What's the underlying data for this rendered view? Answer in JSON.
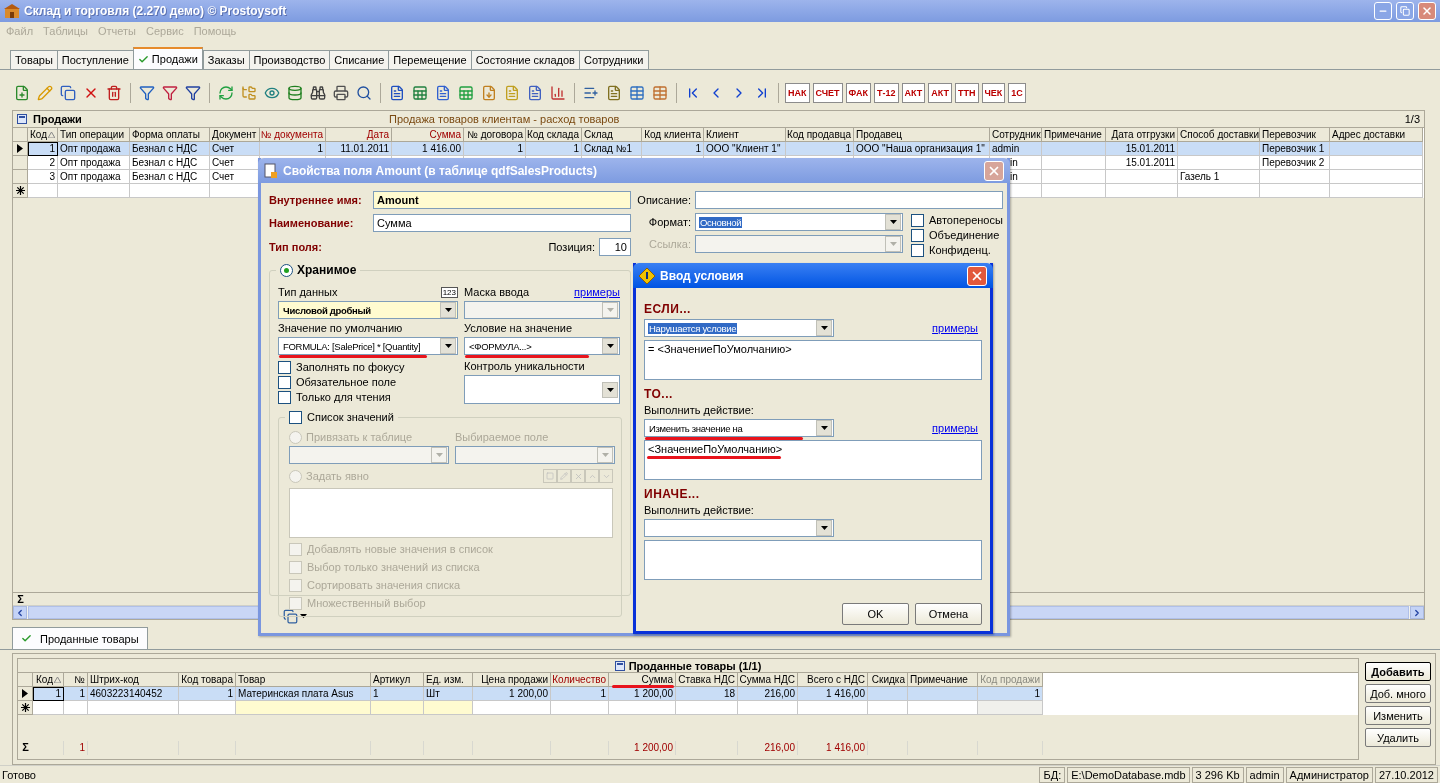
{
  "window": {
    "title": "Склад и торговля (2.270 демо) © Prostoysoft"
  },
  "menu": [
    {
      "label": "Файл",
      "disabled": true
    },
    {
      "label": "Таблицы",
      "disabled": true
    },
    {
      "label": "Отчеты",
      "disabled": true
    },
    {
      "label": "Сервис",
      "disabled": true
    },
    {
      "label": "Помощь",
      "disabled": true
    }
  ],
  "tabs": [
    {
      "label": "Товары",
      "selected": false
    },
    {
      "label": "Поступление",
      "selected": false
    },
    {
      "label": "Продажи",
      "selected": true
    },
    {
      "label": "Заказы",
      "selected": false
    },
    {
      "label": "Производство",
      "selected": false
    },
    {
      "label": "Списание",
      "selected": false
    },
    {
      "label": "Перемещение",
      "selected": false
    },
    {
      "label": "Состояние складов",
      "selected": false
    },
    {
      "label": "Сотрудники",
      "selected": false
    }
  ],
  "toolbar": {
    "doc_buttons": [
      "НАК",
      "СЧЕТ",
      "ФАК",
      "Т-12",
      "АКТ",
      "АКТ",
      "ТТН",
      "ЧЕК",
      "1С"
    ]
  },
  "sales": {
    "title": "Продажи",
    "subtitle": "Продажа товаров клиентам - расход товаров",
    "pager": "1/3",
    "sigma": "Σ",
    "columns": [
      {
        "label": "Код",
        "kind": "number",
        "highlighted": false,
        "sorted": true
      },
      {
        "label": "Тип операции",
        "kind": "text",
        "highlighted": false
      },
      {
        "label": "Форма оплаты",
        "kind": "text",
        "highlighted": false
      },
      {
        "label": "Документ",
        "kind": "text",
        "highlighted": false
      },
      {
        "label": "№ документа",
        "kind": "number",
        "highlighted": true
      },
      {
        "label": "Дата",
        "kind": "number",
        "highlighted": true
      },
      {
        "label": "Сумма",
        "kind": "number",
        "highlighted": true
      },
      {
        "label": "№ договора",
        "kind": "number",
        "highlighted": false
      },
      {
        "label": "Код склада",
        "kind": "number",
        "highlighted": false
      },
      {
        "label": "Склад",
        "kind": "text",
        "highlighted": false
      },
      {
        "label": "Код клиента",
        "kind": "number",
        "highlighted": false
      },
      {
        "label": "Клиент",
        "kind": "text",
        "highlighted": false
      },
      {
        "label": "Код продавца",
        "kind": "number",
        "highlighted": false
      },
      {
        "label": "Продавец",
        "kind": "text",
        "highlighted": false
      },
      {
        "label": "Сотрудник",
        "kind": "text",
        "highlighted": false
      },
      {
        "label": "Примечание",
        "kind": "text",
        "highlighted": false
      },
      {
        "label": "Дата отгрузки",
        "kind": "number",
        "highlighted": false
      },
      {
        "label": "Способ доставки",
        "kind": "text",
        "highlighted": false
      },
      {
        "label": "Перевозчик",
        "kind": "text",
        "highlighted": false
      },
      {
        "label": "Адрес доставки",
        "kind": "text",
        "highlighted": false
      }
    ],
    "rows": [
      {
        "selected": true,
        "cells": [
          {
            "text": "1"
          },
          {
            "text": "Опт продажа"
          },
          {
            "text": "Безнал с НДС"
          },
          {
            "text": "Счет"
          },
          {
            "text": "1"
          },
          {
            "text": "11.01.2011"
          },
          {
            "text": "1 416.00"
          },
          {
            "text": "1"
          },
          {
            "text": "1"
          },
          {
            "text": "Склад №1"
          },
          {
            "text": "1"
          },
          {
            "text": "ООО \"Клиент 1\""
          },
          {
            "text": "1"
          },
          {
            "text": "ООО \"Наша организация 1\""
          },
          {
            "text": "admin"
          },
          {},
          {
            "text": "15.01.2011"
          },
          {},
          {
            "text": "Перевозчик 1"
          },
          {}
        ]
      },
      {
        "selected": false,
        "cells": [
          {
            "text": "2"
          },
          {
            "text": "Опт продажа"
          },
          {
            "text": "Безнал с НДС"
          },
          {
            "text": "Счет"
          },
          {},
          {},
          {},
          {},
          {},
          {},
          {},
          {},
          {},
          {},
          {
            "text": "in"
          },
          {},
          {
            "text": "15.01.2011"
          },
          {},
          {
            "text": "Перевозчик 2"
          },
          {}
        ]
      },
      {
        "selected": false,
        "cells": [
          {
            "text": "3"
          },
          {
            "text": "Опт продажа"
          },
          {
            "text": "Безнал с НДС"
          },
          {
            "text": "Счет"
          },
          {},
          {},
          {},
          {},
          {},
          {},
          {},
          {},
          {},
          {},
          {
            "text": "in"
          },
          {},
          {},
          {
            "text": "Газель 1"
          },
          {},
          {}
        ]
      }
    ]
  },
  "detail_tab": {
    "label": "Проданные товары",
    "selected": true
  },
  "sold": {
    "title": "Проданные товары (1/1)",
    "columns": [
      {
        "label": "Код",
        "kind": "number",
        "sorted": true
      },
      {
        "label": "№",
        "kind": "number",
        "total": "1"
      },
      {
        "label": "Штрих-код",
        "kind": "text"
      },
      {
        "label": "Код товара",
        "kind": "number"
      },
      {
        "label": "Товар",
        "kind": "text",
        "lookup": true
      },
      {
        "label": "Артикул",
        "kind": "text",
        "lookup": true
      },
      {
        "label": "Ед. изм.",
        "kind": "text",
        "lookup": true
      },
      {
        "label": "Цена продажи",
        "kind": "number"
      },
      {
        "label": "Количество",
        "kind": "number",
        "highlighted": true
      },
      {
        "label": "Сумма",
        "kind": "number",
        "annotated": true,
        "total": "1 200,00"
      },
      {
        "label": "Ставка НДС",
        "kind": "number"
      },
      {
        "label": "Сумма НДС",
        "kind": "number",
        "total": "216,00"
      },
      {
        "label": "Всего с НДС",
        "kind": "number",
        "total": "1 416,00"
      },
      {
        "label": "Скидка",
        "kind": "number"
      },
      {
        "label": "Примечание",
        "kind": "text"
      },
      {
        "label": "Код продажи",
        "kind": "number",
        "disabled": true
      }
    ],
    "rows": [
      {
        "selected": true,
        "cells": [
          {
            "text": "1"
          },
          {
            "text": "1"
          },
          {
            "text": "4603223140452"
          },
          {
            "text": "1"
          },
          {
            "text": "Материнская плата Asus"
          },
          {
            "text": "1"
          },
          {
            "text": "Шт"
          },
          {
            "text": "1 200,00"
          },
          {
            "text": "1"
          },
          {
            "text": "1 200,00"
          },
          {
            "text": "18"
          },
          {
            "text": "216,00"
          },
          {
            "text": "1 416,00"
          },
          {},
          {},
          {
            "text": "1"
          }
        ]
      }
    ],
    "totals_label": "Σ"
  },
  "buttons": [
    {
      "label": "Добавить",
      "default": true
    },
    {
      "label": "Доб. много",
      "default": false
    },
    {
      "label": "Изменить",
      "default": false
    },
    {
      "label": "Удалить",
      "default": false
    }
  ],
  "status_bar": {
    "message": "Готово",
    "panes": [
      "БД:",
      "E:\\DemoDatabase.mdb",
      "3 296 Kb",
      "admin",
      "Администратор",
      "27.10.2012"
    ]
  },
  "field_dialog": {
    "title": "Свойства поля Amount (в таблице qdfSalesProducts)",
    "internal_name": {
      "label": "Внутреннее имя:",
      "value": "Amount"
    },
    "name": {
      "label": "Наименование:",
      "value": "Сумма"
    },
    "field_type_label": "Тип поля:",
    "position": {
      "label": "Позиция:",
      "value": "10"
    },
    "description": {
      "label": "Описание:"
    },
    "format": {
      "label": "Формат:",
      "value": "Основной",
      "highlighted": true
    },
    "link": {
      "label": "Ссылка:",
      "disabled": true
    },
    "options": [
      {
        "label": "Автопереносы",
        "checked": false
      },
      {
        "label": "Объединение",
        "checked": false
      },
      {
        "label": "Конфиденц.",
        "checked": false
      }
    ],
    "storage": {
      "label": "Хранимое",
      "selected": true
    },
    "data_type": {
      "label": "Тип данных",
      "badge": "123",
      "value": "Числовой дробный"
    },
    "input_mask": {
      "label": "Маска ввода",
      "link": "примеры",
      "disabled": true
    },
    "default_value": {
      "label": "Значение по умолчанию",
      "value": "FORMULA: [SalePrice] * [Quantity]",
      "annotated": true
    },
    "value_condition": {
      "label": "Условие на значение",
      "value": "<ФОРМУЛА...>",
      "annotated": true
    },
    "uniqueness": {
      "label": "Контроль уникальности"
    },
    "flags": [
      {
        "label": "Заполнять по фокусу",
        "checked": false
      },
      {
        "label": "Обязательное поле",
        "checked": false
      },
      {
        "label": "Только для чтения",
        "checked": false
      }
    ],
    "value_list": {
      "label": "Список значений",
      "checked": false,
      "disabled": true,
      "bind_table": {
        "label": "Привязать к таблице",
        "selected": false
      },
      "chosen_field": {
        "label": "Выбираемое поле"
      },
      "explicit": {
        "label": "Задать явно",
        "selected": false
      },
      "list_options": [
        {
          "label": "Добавлять новые значения в список",
          "checked": false
        },
        {
          "label": "Выбор только значений из списка",
          "checked": false
        },
        {
          "label": "Сортировать значения списка",
          "checked": false
        },
        {
          "label": "Множественный выбор",
          "checked": false
        }
      ]
    }
  },
  "condition_dialog": {
    "title": "Ввод условия",
    "if": {
      "heading": "ЕСЛИ...",
      "value": "Нарушается условие",
      "highlighted": true,
      "link": "примеры",
      "expression": "= <ЗначениеПоУмолчанию>"
    },
    "then": {
      "heading": "ТО...",
      "action_label": "Выполнить действие:",
      "value": "Изменить значение на",
      "annotated": true,
      "link": "примеры",
      "expression": "<ЗначениеПоУмолчанию>",
      "expression_annotated": true
    },
    "else": {
      "heading": "ИНАЧЕ...",
      "action_label": "Выполнить действие:"
    },
    "buttons": [
      "OK",
      "Отмена"
    ]
  }
}
